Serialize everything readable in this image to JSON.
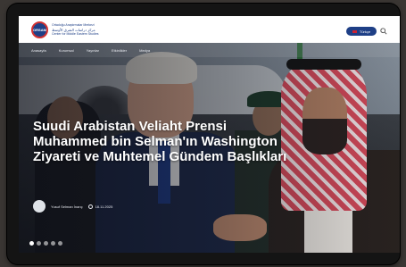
{
  "header": {
    "logo_mark": "ORSAM",
    "logo_lines": [
      "Ortadoğu Araştırmalar Merkezi",
      "مركز دراسات الشرق الأوسط",
      "Center for Middle Eastern Studies"
    ],
    "language_label": "Türkçe"
  },
  "nav": {
    "items": [
      "Anasayfa",
      "Kurumsal",
      "Yayınlar",
      "Etkinlikler",
      "Medya"
    ]
  },
  "hero": {
    "headline": "Suudi Arabistan Veliaht Prensi Muhammed bin Selman'ın Washington Ziyareti ve Muhtemel Gündem Başlıkları",
    "author": "Yusuf Selman İnanç",
    "date": "18.11.2025",
    "slides_total": 5,
    "active_slide": 1
  },
  "colors": {
    "brand": "#1e3f86",
    "accent": "#d23232"
  }
}
